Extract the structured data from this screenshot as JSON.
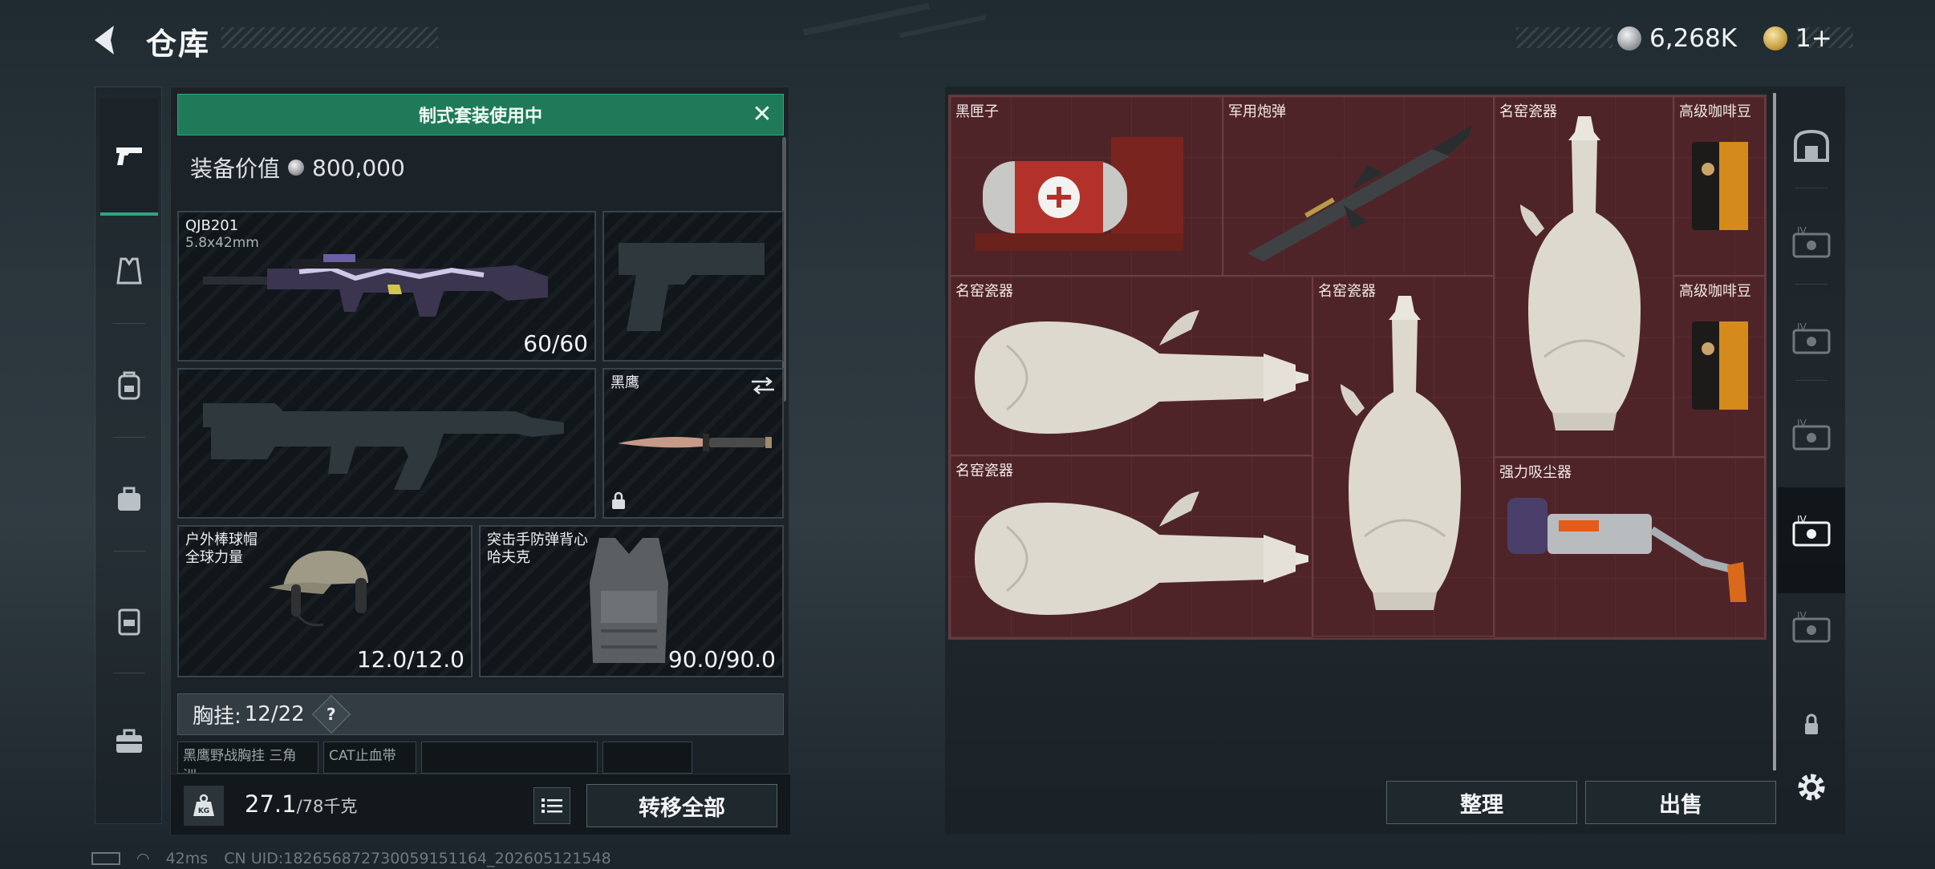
{
  "header": {
    "title": "仓库"
  },
  "currency": {
    "silver_amount": "6,268K",
    "gold_amount": "1+"
  },
  "equip": {
    "banner_label": "制式套装使用中",
    "value_label": "装备价值",
    "value": "800,000",
    "primary": {
      "name": "QJB201",
      "ammo_type": "5.8x42mm",
      "count": "60/60"
    },
    "melee": {
      "name": "黑鹰"
    },
    "helmet": {
      "name": "户外棒球帽",
      "brand": "全球力量",
      "durability": "12.0/12.0"
    },
    "armor": {
      "name": "突击手防弹背心",
      "brand": "哈夫克",
      "durability": "90.0/90.0"
    },
    "chest": {
      "label": "胸挂:",
      "count": "12/22",
      "help": "?"
    },
    "mini_slots": [
      "黑鹰野战胸挂 三角洲...",
      "CAT止血带"
    ],
    "weight": {
      "current": "27.1",
      "max": "/78千克"
    },
    "transfer_label": "转移全部",
    "kg_label": "KG"
  },
  "storage": {
    "items": [
      {
        "label": "黑匣子",
        "icon": "black-box"
      },
      {
        "label": "军用炮弹",
        "icon": "military-shell"
      },
      {
        "label": "名窑瓷器",
        "icon": "porcelain-vase"
      },
      {
        "label": "高级咖啡豆",
        "icon": "coffee-bag"
      },
      {
        "label": "名窑瓷器",
        "icon": "porcelain-vase"
      },
      {
        "label": "名窑瓷器",
        "icon": "porcelain-vase"
      },
      {
        "label": "高级咖啡豆",
        "icon": "coffee-bag"
      },
      {
        "label": "名窑瓷器",
        "icon": "porcelain-vase"
      },
      {
        "label": "强力吸尘器",
        "icon": "vacuum-cleaner"
      }
    ],
    "tidy_label": "整理",
    "sell_label": "出售"
  },
  "right_rail": {
    "tier_label": "IV"
  },
  "status": {
    "ping": "42ms",
    "uid": "CN UID:182656872730059151164_202605121548"
  },
  "colors": {
    "accent_green": "#1f7a5a",
    "grid_red": "#52282c"
  }
}
